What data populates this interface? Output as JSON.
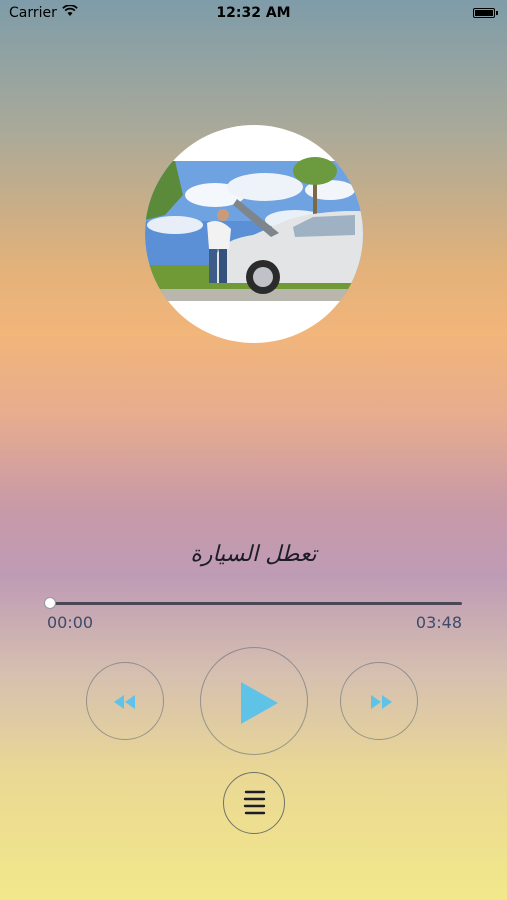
{
  "status_bar": {
    "carrier": "Carrier",
    "time": "12:32 AM",
    "wifi_icon": "wifi-icon",
    "battery_icon": "battery-icon"
  },
  "player": {
    "album_art_icon": "album-art-image",
    "track_title": "تعطل السيارة",
    "elapsed": "00:00",
    "total": "03:48",
    "progress_fraction": 0.0
  },
  "controls": {
    "rewind_icon": "rewind-icon",
    "play_icon": "play-icon",
    "forward_icon": "fast-forward-icon",
    "playlist_icon": "list-menu-icon"
  },
  "colors": {
    "accent": "#5fc3e8",
    "icon_dark": "#1d1d2a"
  }
}
